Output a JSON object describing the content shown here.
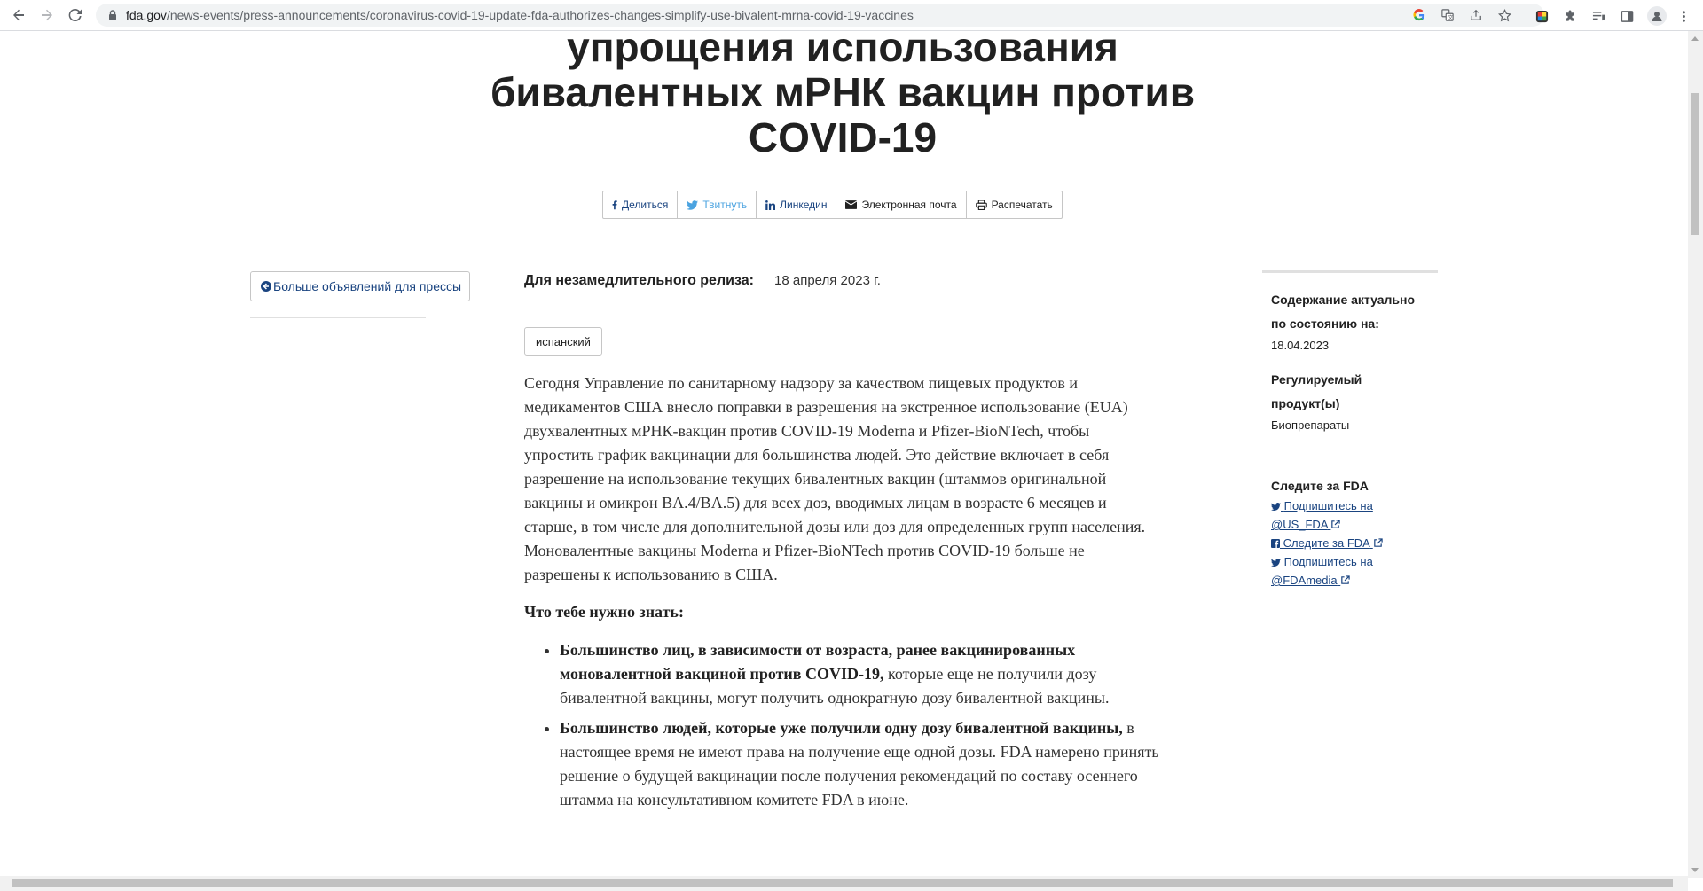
{
  "browser": {
    "url_domain": "fda.gov",
    "url_path": "/news-events/press-announcements/coronavirus-covid-19-update-fda-authorizes-changes-simplify-use-bivalent-mrna-covid-19-vaccines"
  },
  "article": {
    "headline_lines": [
      "упрощения использования",
      "бивалентных мРНК вакцин против",
      "COVID-19"
    ],
    "share": {
      "facebook": "Делиться",
      "twitter": "Твитнуть",
      "linkedin": "Линкедин",
      "email": "Электронная почта",
      "print": "Распечатать"
    },
    "back_label": "Больше объявлений для прессы",
    "release_label": "Для незамедлительного релиза:",
    "release_date": "18 апреля 2023 г.",
    "language_label": "испанский",
    "intro": "Сегодня Управление по санитарному надзору за качеством пищевых продуктов и медикаментов США внесло поправки в разрешения на экстренное использование (EUA) двухвалентных мРНК-вакцин против COVID-19 Moderna и Pfizer-BioNTech, чтобы упростить график вакцинации для большинства людей. Это действие включает в себя разрешение на использование текущих бивалентных вакцин (штаммов оригинальной вакцины и омикрон BA.4/BA.5) для всех доз, вводимых лицам в возрасте 6 месяцев и старше, в том числе для дополнительной дозы или доз для определенных групп населения. Моновалентные вакцины Moderna и Pfizer-BioNTech против COVID-19 больше не разрешены к использованию в США.",
    "subheading": "Что тебе нужно знать:",
    "bullets": [
      {
        "bold": "Большинство лиц, в зависимости от возраста, ранее вакцинированных моновалентной вакциной против COVID-19,",
        "text": " которые еще не получили дозу бивалентной вакцины, могут получить однократную дозу бивалентной вакцины."
      },
      {
        "bold": "Большинство людей, которые уже получили одну дозу бивалентной вакцины,",
        "text": " в настоящее время не имеют права на получение еще одной дозы. FDA намерено принять решение о будущей вакцинации после получения рекомендаций по составу осеннего штамма на консультативном комитете FDA в июне."
      }
    ]
  },
  "sidebar": {
    "current_label": "Содержание актуально по состоянию на:",
    "current_value": "18.04.2023",
    "product_label": "Регулируемый продукт(ы)",
    "product_value": "Биопрепараты",
    "follow_title": "Следите за FDA",
    "links": [
      "Подпишитесь на @US_FDA",
      "Следите за FDA",
      "Подпишитесь на @FDAmedia"
    ]
  }
}
